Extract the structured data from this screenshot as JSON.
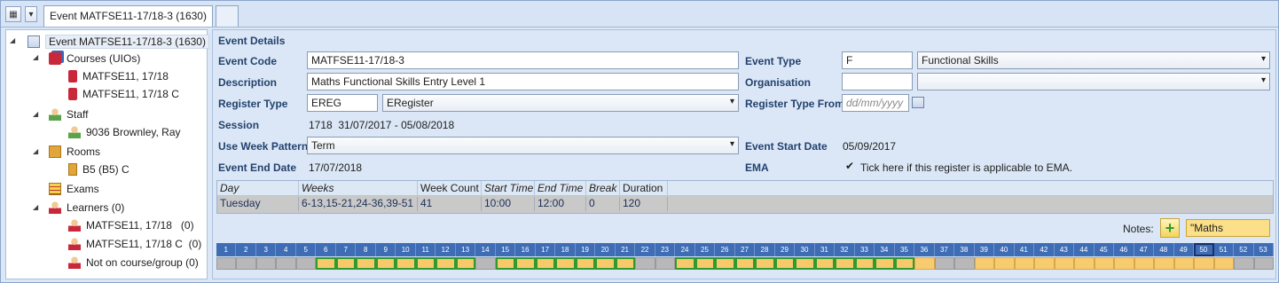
{
  "tab": {
    "title": "Event MATFSE11-17/18-3 (1630)"
  },
  "tree": {
    "root": "Event MATFSE11-17/18-3 (1630)",
    "courses": "Courses (UIOs)",
    "course_items": [
      "MATFSE11, 17/18",
      "MATFSE11, 17/18 C"
    ],
    "staff": "Staff",
    "staff_items": [
      "9036 Brownley, Ray"
    ],
    "rooms": "Rooms",
    "room_items": [
      "B5 (B5) C"
    ],
    "exams": "Exams",
    "learners": "Learners (0)",
    "learner_items": [
      "MATFSE11, 17/18   (0)",
      "MATFSE11, 17/18 C  (0)",
      "Not on course/group (0)"
    ]
  },
  "details": {
    "section_title": "Event Details",
    "event_code_label": "Event Code",
    "event_code": "MATFSE11-17/18-3",
    "description_label": "Description",
    "description": "Maths Functional Skills Entry Level 1",
    "register_type_label": "Register Type",
    "register_type_code": "EREG",
    "register_type_name": "ERegister",
    "session_label": "Session",
    "session_value": "1718  31/07/2017 - 05/08/2018",
    "week_pattern_label": "Use Week Pattern",
    "week_pattern": "Term",
    "event_end_label": "Event End Date",
    "event_end": "17/07/2018",
    "event_type_label": "Event Type",
    "event_type_code": "F",
    "event_type_name": "Functional Skills",
    "organisation_label": "Organisation",
    "organisation_code": "",
    "organisation_name": "",
    "register_from_label": "Register Type From",
    "register_from_placeholder": "dd/mm/yyyy",
    "event_start_label": "Event Start Date",
    "event_start": "05/09/2017",
    "ema_label": "EMA",
    "ema_text": "Tick here if this register is applicable to EMA.",
    "ema_checked": true
  },
  "schedule": {
    "headers": [
      "Day",
      "Weeks",
      "Week Count",
      "Start Time",
      "End Time",
      "Break",
      "Duration"
    ],
    "rows": [
      [
        "Tuesday",
        "6-13,15-21,24-36,39-51",
        "41",
        "10:00",
        "12:00",
        "0",
        "120"
      ]
    ]
  },
  "notes": {
    "label": "Notes:",
    "value": "\"Maths"
  },
  "weeks": {
    "numbers": [
      "1",
      "2",
      "3",
      "4",
      "5",
      "6",
      "7",
      "8",
      "9",
      "10",
      "11",
      "12",
      "13",
      "14",
      "15",
      "16",
      "17",
      "18",
      "19",
      "20",
      "21",
      "22",
      "23",
      "24",
      "25",
      "26",
      "27",
      "28",
      "29",
      "30",
      "31",
      "32",
      "33",
      "34",
      "35",
      "36",
      "37",
      "38",
      "39",
      "40",
      "41",
      "42",
      "43",
      "44",
      "45",
      "46",
      "47",
      "48",
      "49",
      "50",
      "51",
      "52",
      "53"
    ],
    "selected_week": "50"
  }
}
